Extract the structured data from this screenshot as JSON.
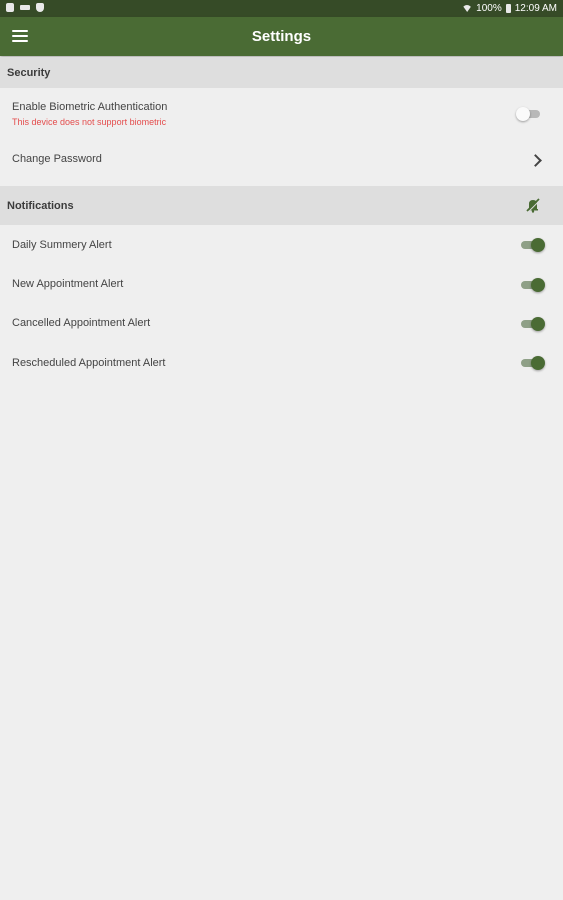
{
  "status_bar": {
    "battery": "100%",
    "time": "12:09 AM",
    "icons": [
      "lock-icon",
      "key-icon",
      "shield-icon",
      "wifi-icon",
      "battery-icon"
    ]
  },
  "app_bar": {
    "title": "Settings",
    "menu_icon": "hamburger-menu-icon"
  },
  "security": {
    "header": "Security",
    "biometric": {
      "label": "Enable Biometric Authentication",
      "sublabel": "This device does not support biometric",
      "enabled": false
    },
    "change_password": {
      "label": "Change Password",
      "icon": "chevron-right-icon"
    }
  },
  "notifications": {
    "header": "Notifications",
    "header_icon": "bell-off-icon",
    "items": [
      {
        "label": "Daily Summery Alert",
        "enabled": true
      },
      {
        "label": "New Appointment Alert",
        "enabled": true
      },
      {
        "label": "Cancelled Appointment Alert",
        "enabled": true
      },
      {
        "label": "Rescheduled Appointment Alert",
        "enabled": true
      }
    ]
  },
  "colors": {
    "status_bar": "#364b27",
    "app_bar": "#4a6b34",
    "toggle_on": "#4a6b34",
    "warning_text": "#e44d4d",
    "background": "#efefef",
    "section_header": "#dedede"
  }
}
